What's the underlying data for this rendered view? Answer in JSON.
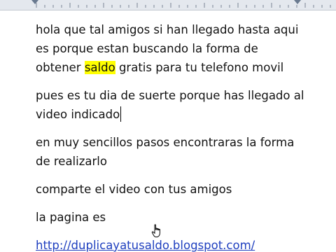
{
  "document": {
    "paragraphs": [
      {
        "lines": [
          "hola que tal amigos si han llegado hasta aqui",
          "es porque estan buscando la forma de"
        ],
        "last_line": {
          "before": "obtener ",
          "highlight": "saldo",
          "after": " gratis para tu telefono movil"
        }
      },
      {
        "lines": [
          "pues es tu dia de suerte porque has llegado al",
          "video indicado"
        ]
      },
      {
        "lines": [
          "en muy sencillos pasos encontraras la forma",
          "de realizarlo"
        ]
      },
      {
        "lines": [
          "comparte el video con tus amigos"
        ]
      },
      {
        "lines": [
          "la pagina es"
        ]
      }
    ],
    "link": "http://duplicayatusaldo.blogspot.com/",
    "highlight_color": "#ffff00",
    "link_color": "#1f3fbf",
    "cursor_icon": "hand-pointer-icon"
  }
}
